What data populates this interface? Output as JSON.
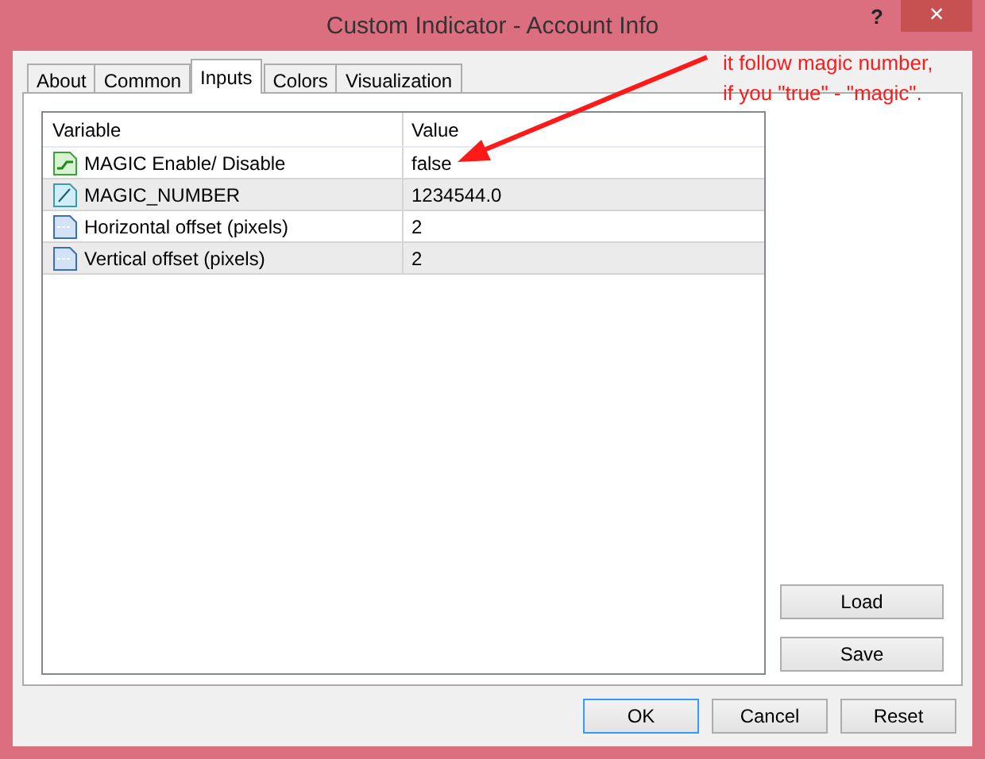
{
  "window": {
    "title": "Custom Indicator - Account Info",
    "help": "?",
    "close": "×"
  },
  "tabs": [
    {
      "label": "About",
      "selected": false
    },
    {
      "label": "Common",
      "selected": false
    },
    {
      "label": "Inputs",
      "selected": true
    },
    {
      "label": "Colors",
      "selected": false
    },
    {
      "label": "Visualization",
      "selected": false
    }
  ],
  "table": {
    "columns": [
      "Variable",
      "Value"
    ],
    "rows": [
      {
        "kind": "bool",
        "variable": "MAGIC Enable/ Disable",
        "value": "false"
      },
      {
        "kind": "double",
        "variable": "MAGIC_NUMBER",
        "value": "1234544.0"
      },
      {
        "kind": "int",
        "variable": "Horizontal offset (pixels)",
        "value": "2"
      },
      {
        "kind": "int",
        "variable": "Vertical offset (pixels)",
        "value": "2"
      }
    ]
  },
  "side_buttons": [
    "Load",
    "Save"
  ],
  "buttons": [
    "OK",
    "Cancel",
    "Reset"
  ],
  "annotation": {
    "lines": [
      "it follow magic number,",
      "if you \"true\" - \"magic\"."
    ]
  }
}
